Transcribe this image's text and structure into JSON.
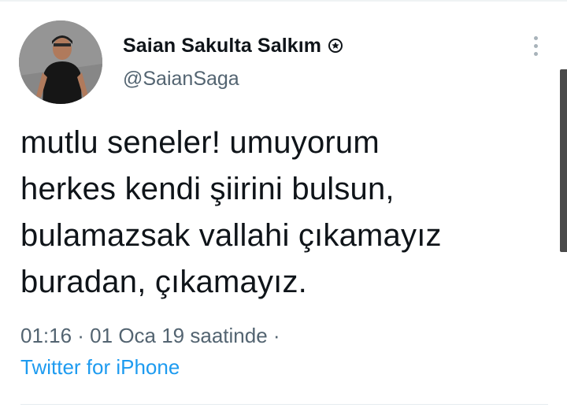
{
  "author": {
    "display_name": "Saian Sakulta Salkım",
    "handle": "@SaianSaga",
    "badge_icon": "circle-badge-icon"
  },
  "tweet": {
    "text": "mutlu seneler! umuyorum\nherkes kendi şiirini bulsun,\nbulamazsak vallahi çıkamayız\nburadan, çıkamayız.",
    "timestamp": "01:16 · 01 Oca 19 saatinde ·",
    "source": "Twitter for iPhone"
  },
  "icons": {
    "more": "more-vertical-icon"
  },
  "colors": {
    "text_primary": "#0f1419",
    "text_secondary": "#536471",
    "link": "#1d9bf0"
  }
}
